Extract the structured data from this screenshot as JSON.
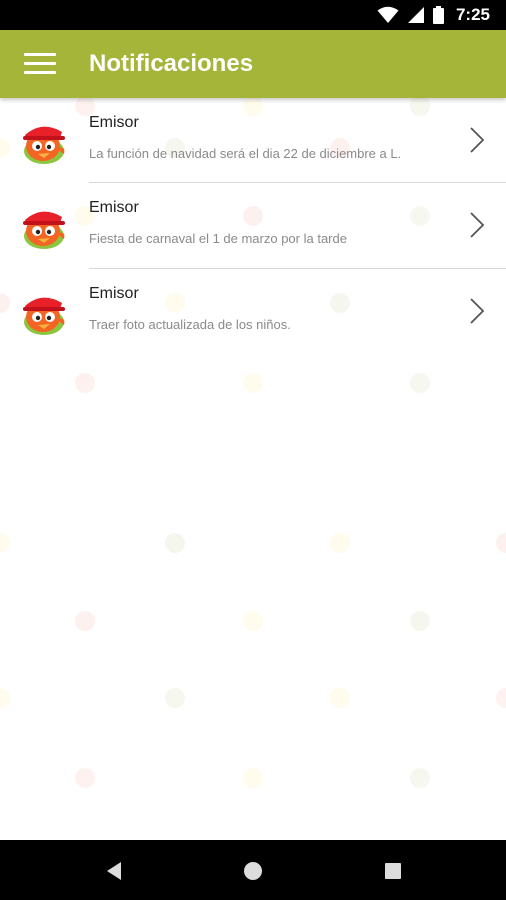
{
  "status_bar": {
    "time": "7:25",
    "icons": [
      "wifi-icon",
      "cellular-signal-icon",
      "battery-icon"
    ]
  },
  "app_bar": {
    "menu_icon": "hamburger-menu-icon",
    "title": "Notificaciones",
    "color": "#a4b53a"
  },
  "notifications": [
    {
      "sender": "Emisor",
      "message": "La función de navidad será el dia 22 de diciembre a L.",
      "avatar": "bird-mascot-avatar",
      "action_icon": "chevron-right-icon"
    },
    {
      "sender": "Emisor",
      "message": "Fiesta de carnaval el 1 de marzo por la tarde",
      "avatar": "bird-mascot-avatar",
      "action_icon": "chevron-right-icon"
    },
    {
      "sender": "Emisor",
      "message": "Traer foto actualizada de los niños.",
      "avatar": "bird-mascot-avatar",
      "action_icon": "chevron-right-icon"
    }
  ],
  "nav_bar": {
    "buttons": [
      "back-icon",
      "home-icon",
      "recents-icon"
    ]
  }
}
